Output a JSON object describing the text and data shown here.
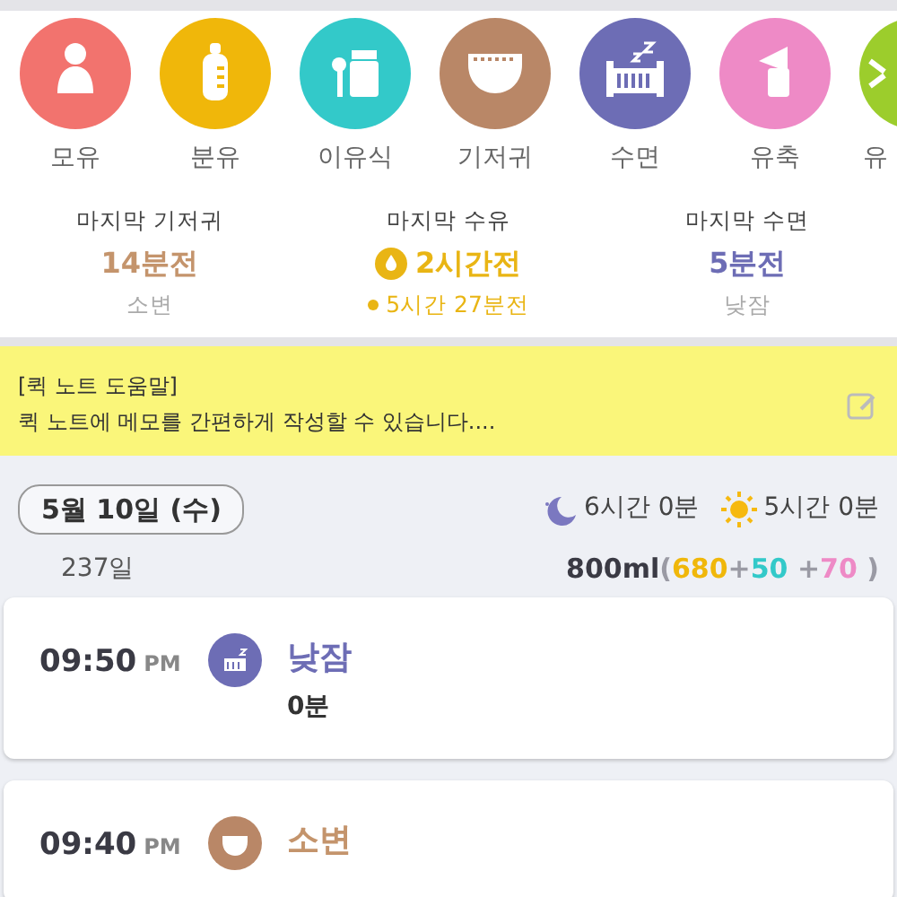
{
  "categories": [
    {
      "label": "모유",
      "color": "#f2736e"
    },
    {
      "label": "분유",
      "color": "#f0b70a"
    },
    {
      "label": "이유식",
      "color": "#33c9c9"
    },
    {
      "label": "기저귀",
      "color": "#b98767"
    },
    {
      "label": "수면",
      "color": "#6d6db5"
    },
    {
      "label": "유축",
      "color": "#ee8ac6"
    },
    {
      "label": "유",
      "color": "#9ccd2c"
    }
  ],
  "last_events": [
    {
      "title": "마지막 기저귀",
      "value": "14분전",
      "sub": "소변",
      "kind": "diaper"
    },
    {
      "title": "마지막 수유",
      "value": "2시간전",
      "sub": "5시간 27분전",
      "kind": "feed"
    },
    {
      "title": "마지막 수면",
      "value": "5분전",
      "sub": "낮잠",
      "kind": "sleep"
    }
  ],
  "quick_note": {
    "title": "[퀵 노트 도움말]",
    "text": "퀵 노트에 메모를 간편하게 작성할 수 있습니다...."
  },
  "day": {
    "date": "5월 10일 (수)",
    "age": "237일",
    "night_sleep": "6시간 0분",
    "day_sleep": "5시간 0분",
    "total": "800ml",
    "breakdown": [
      {
        "text": "(",
        "color": "#9a9aa4"
      },
      {
        "text": "680",
        "color": "#f0b70a"
      },
      {
        "text": "+",
        "color": "#9a9aa4"
      },
      {
        "text": "50",
        "color": "#33c9c9"
      },
      {
        "text": " +",
        "color": "#9a9aa4"
      },
      {
        "text": "70",
        "color": "#ee8ac6"
      },
      {
        "text": " )",
        "color": "#9a9aa4"
      }
    ]
  },
  "entries": [
    {
      "time": "09:50",
      "ampm": "PM",
      "kind": "sleep",
      "title": "낮잠",
      "detail": "0분"
    },
    {
      "time": "09:40",
      "ampm": "PM",
      "kind": "diaper",
      "title": "소변"
    }
  ]
}
